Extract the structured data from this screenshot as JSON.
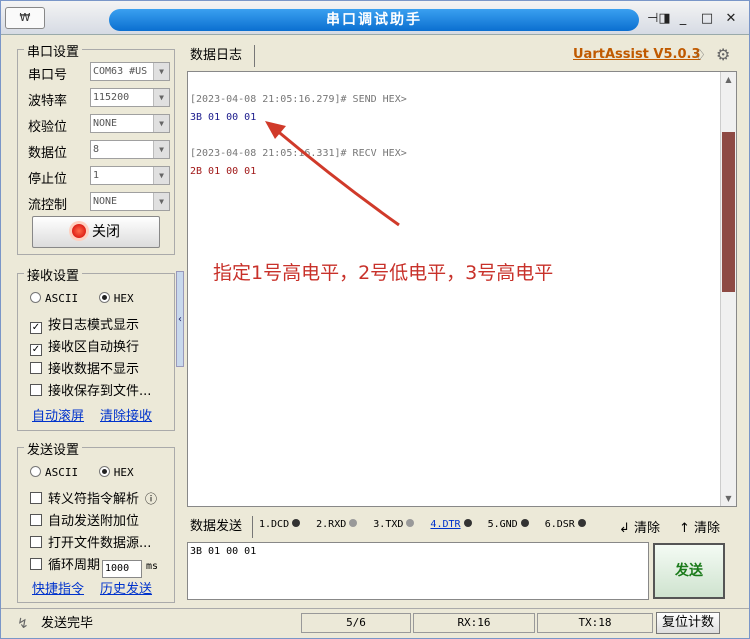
{
  "window": {
    "title": "串口调试助手",
    "app_icon": "₩"
  },
  "titlebar_buttons": {
    "pin": "⊣◨",
    "min": "_",
    "max": "□",
    "close": "✕"
  },
  "serial": {
    "group_title": "串口设置",
    "rows": [
      {
        "label": "串口号",
        "value": "COM63 #US"
      },
      {
        "label": "波特率",
        "value": "115200"
      },
      {
        "label": "校验位",
        "value": "NONE"
      },
      {
        "label": "数据位",
        "value": "8"
      },
      {
        "label": "停止位",
        "value": "1"
      },
      {
        "label": "流控制",
        "value": "NONE"
      }
    ],
    "open_button": "关闭"
  },
  "receive": {
    "group_title": "接收设置",
    "ascii": "ASCII",
    "hex": "HEX",
    "options": [
      {
        "label": "按日志模式显示",
        "checked": true
      },
      {
        "label": "接收区自动换行",
        "checked": true
      },
      {
        "label": "接收数据不显示",
        "checked": false
      },
      {
        "label": "接收保存到文件...",
        "checked": false
      }
    ],
    "link_auto_scroll": "自动滚屏",
    "link_clear": "清除接收"
  },
  "send": {
    "group_title": "发送设置",
    "ascii": "ASCII",
    "hex": "HEX",
    "options": [
      {
        "label": "转义符指令解析",
        "checked": false
      },
      {
        "label": "自动发送附加位",
        "checked": false
      },
      {
        "label": "打开文件数据源...",
        "checked": false
      }
    ],
    "cycle_label": "循环周期",
    "cycle_value": "1000",
    "cycle_unit": "ms",
    "link_shortcut": "快捷指令",
    "link_history": "历史发送",
    "info_icon": "ⓘ"
  },
  "log": {
    "tab": "数据日志",
    "brand": "UartAssist V5.0.3",
    "lines": [
      {
        "text": "[2023-04-08 21:05:16.279]# SEND HEX>",
        "color": "#777777"
      },
      {
        "text": "3B 01 00 01",
        "color": "#1a1a8c"
      },
      {
        "text": "[2023-04-08 21:05:16.331]# RECV HEX>",
        "color": "#777777"
      },
      {
        "text": "2B 01 00 01",
        "color": "#a01818"
      }
    ],
    "annotation": "指定1号高电平，2号低电平，3号高电平"
  },
  "send_panel": {
    "tab": "数据发送",
    "pins": [
      {
        "label": "1.DCD",
        "led": "dark"
      },
      {
        "label": "2.RXD",
        "led": "gray"
      },
      {
        "label": "3.TXD",
        "led": "gray"
      },
      {
        "label": "4.DTR",
        "led": "dark"
      },
      {
        "label": "5.GND",
        "led": "dark"
      },
      {
        "label": "6.DSR",
        "led": "dark"
      }
    ],
    "clear_a": "清除",
    "clear_b": "清除",
    "input_value": "3B 01 00 01",
    "send_button": "发送"
  },
  "status": {
    "text": "发送完毕",
    "count": "5/6",
    "rx": "RX:16",
    "tx": "TX:18",
    "reset": "复位计数"
  }
}
